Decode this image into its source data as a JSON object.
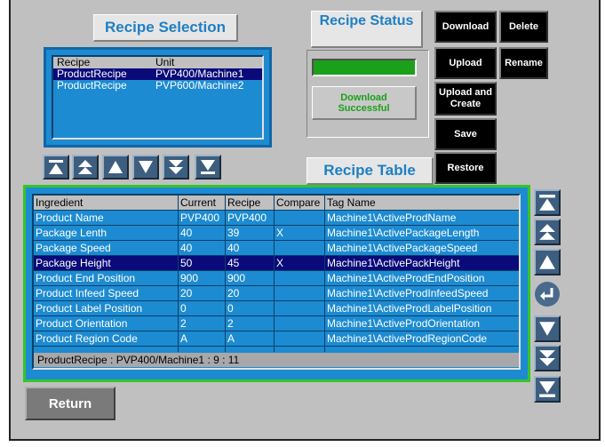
{
  "selection_title": "Recipe Selection",
  "status_title": "Recipe Status",
  "status_message": "Download Successful",
  "table_title": "Recipe Table",
  "recipe_list": {
    "headers": {
      "recipe": "Recipe",
      "unit": "Unit"
    },
    "rows": [
      {
        "recipe": "ProductRecipe",
        "unit": "PVP400/Machine1"
      },
      {
        "recipe": "ProductRecipe",
        "unit": "PVP600/Machine2"
      }
    ]
  },
  "buttons": {
    "download": "Download",
    "delete": "Delete",
    "upload": "Upload",
    "rename": "Rename",
    "upload_create": "Upload and\nCreate",
    "save": "Save",
    "restore": "Restore",
    "return": "Return"
  },
  "table": {
    "headers": {
      "ingredient": "Ingredient",
      "current": "Current",
      "recipe": "Recipe",
      "compare": "Compare",
      "tag": "Tag Name"
    },
    "rows": [
      {
        "ingredient": "Product Name",
        "current": "PVP400",
        "recipe": "PVP400",
        "compare": "",
        "tag": "Machine1\\ActiveProdName"
      },
      {
        "ingredient": "Package Lenth",
        "current": "40",
        "recipe": "39",
        "compare": "X",
        "tag": "Machine1\\ActivePackageLength"
      },
      {
        "ingredient": "Package Speed",
        "current": "40",
        "recipe": "40",
        "compare": "",
        "tag": "Machine1\\ActivePackageSpeed"
      },
      {
        "ingredient": "Package Height",
        "current": "50",
        "recipe": "45",
        "compare": "X",
        "tag": "Machine1\\ActivePackHeight"
      },
      {
        "ingredient": "Product End Position",
        "current": "900",
        "recipe": "900",
        "compare": "",
        "tag": "Machine1\\ActiveProdEndPosition"
      },
      {
        "ingredient": "Product Infeed Speed",
        "current": "20",
        "recipe": "20",
        "compare": "",
        "tag": "Machine1\\ActiveProdInfeedSpeed"
      },
      {
        "ingredient": "Product Label Position",
        "current": "0",
        "recipe": "0",
        "compare": "",
        "tag": "Machine1\\ActiveProdLabelPosition"
      },
      {
        "ingredient": "Product Orientation",
        "current": "2",
        "recipe": "2",
        "compare": "",
        "tag": "Machine1\\ActiveProdOrientation"
      },
      {
        "ingredient": "Product Region Code",
        "current": "A",
        "recipe": "A",
        "compare": "",
        "tag": "Machine1\\ActiveProdRegionCode"
      }
    ],
    "footer": "ProductRecipe : PVP400/Machine1 : 9 : 11"
  },
  "colors": {
    "panel_blue": "#1d8bd1",
    "selected_row": "#0a0a7a",
    "table_border": "#35c52a",
    "status_green": "#1aa01a",
    "title_blue": "#1f7fc4"
  },
  "icons": [
    "first-icon",
    "page-up-icon",
    "up-icon",
    "down-icon",
    "page-down-icon",
    "last-icon",
    "enter-icon"
  ]
}
